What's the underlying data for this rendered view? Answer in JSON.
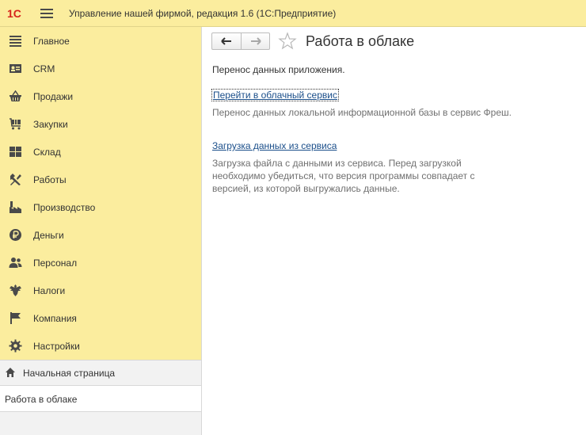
{
  "header": {
    "app_title": "Управление нашей фирмой, редакция 1.6  (1С:Предприятие)",
    "logo_text": "1С"
  },
  "sidebar": {
    "items": [
      {
        "label": "Главное",
        "icon": "list-icon"
      },
      {
        "label": "CRM",
        "icon": "contact-card-icon"
      },
      {
        "label": "Продажи",
        "icon": "basket-icon"
      },
      {
        "label": "Закупки",
        "icon": "cart-icon"
      },
      {
        "label": "Склад",
        "icon": "warehouse-grid-icon"
      },
      {
        "label": "Работы",
        "icon": "tools-icon"
      },
      {
        "label": "Производство",
        "icon": "factory-icon"
      },
      {
        "label": "Деньги",
        "icon": "ruble-icon"
      },
      {
        "label": "Персонал",
        "icon": "people-icon"
      },
      {
        "label": "Налоги",
        "icon": "emblem-icon"
      },
      {
        "label": "Компания",
        "icon": "flag-icon"
      },
      {
        "label": "Настройки",
        "icon": "gear-icon"
      }
    ],
    "home_label": "Начальная страница",
    "open_window_label": "Работа в облаке"
  },
  "main": {
    "title": "Работа в облаке",
    "intro": "Перенос данных приложения.",
    "links": [
      {
        "label": "Перейти в облачный сервис",
        "description": "Перенос данных локальной информационной базы в сервис Фреш."
      },
      {
        "label": "Загрузка данных из сервиса",
        "description": "Загрузка файла с данными из сервиса. Перед загрузкой необходимо убедиться, что версия программы совпадает с версией, из которой выгружались данные."
      }
    ]
  },
  "colors": {
    "accent_yellow": "#fbed9e",
    "logo_red": "#d6221b",
    "link_blue": "#1a4e8a"
  }
}
